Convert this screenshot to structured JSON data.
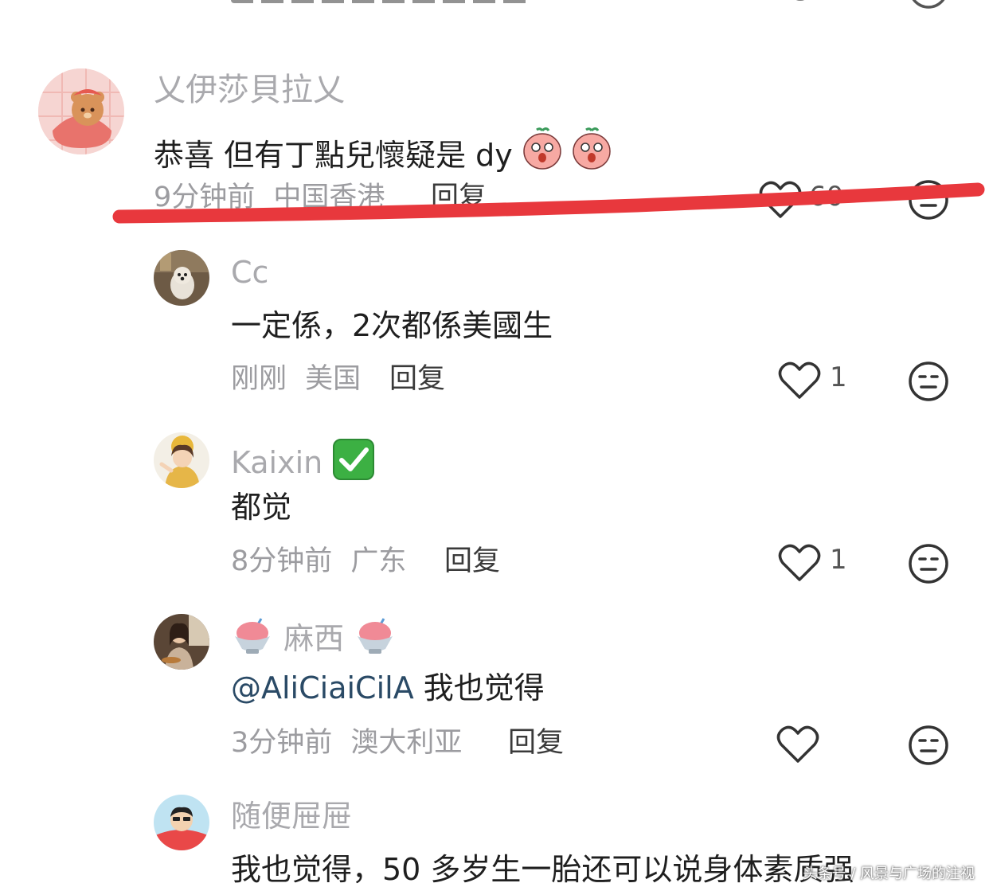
{
  "comments": [
    {
      "username": "乂伊莎貝拉乂",
      "text": "恭喜 但有丁點兒懷疑是 dy",
      "time": "9分钟前",
      "location": "中国香港",
      "reply_label": "回复",
      "likes": "60"
    },
    {
      "username": "Cc",
      "text": "一定係，2次都係美國生",
      "time": "刚刚",
      "location": "美国",
      "reply_label": "回复",
      "likes": "1"
    },
    {
      "username": "Kaixin",
      "text": "都觉",
      "time": "8分钟前",
      "location": "广东",
      "reply_label": "回复",
      "likes": "1"
    },
    {
      "username": "麻西",
      "mention": "@AliCiaiCilA",
      "text": " 我也觉得",
      "time": "3分钟前",
      "location": "澳大利亚",
      "reply_label": "回复",
      "likes": ""
    },
    {
      "username": "随便屉屉",
      "text": "我也觉得，50 多岁生一胎还可以说身体素质强"
    }
  ],
  "watermark": "头条号 / 风景与广场的注视",
  "colors": {
    "annotation_line": "#e8383d",
    "username": "#a9a9ad",
    "mention": "#2a4a66"
  }
}
